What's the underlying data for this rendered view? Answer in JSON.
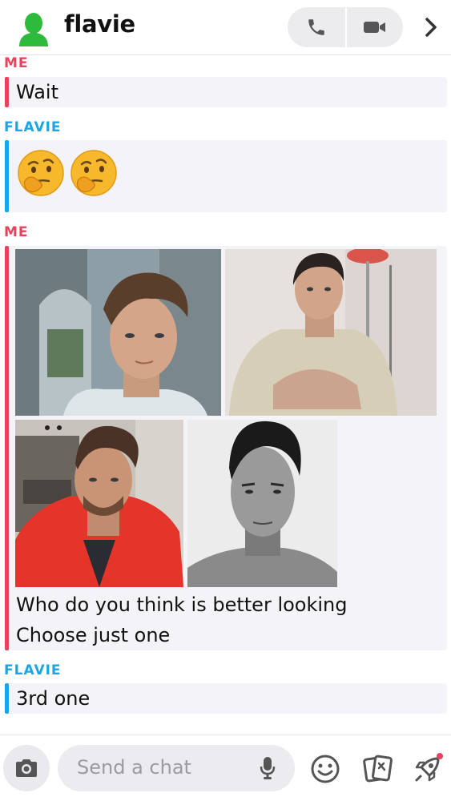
{
  "header": {
    "title": "flavie",
    "avatar_color": "#2eba3c"
  },
  "colors": {
    "me": "#e8425c",
    "flavie": "#1aa5e6",
    "bubble_bg": "#f4f4f8"
  },
  "messages": [
    {
      "sender": "ME",
      "text": "Wait"
    },
    {
      "sender": "FLAVIE",
      "emojis": [
        "thinking-face-emoji",
        "thinking-face-emoji"
      ]
    },
    {
      "sender": "ME",
      "photos": [
        "photo-1",
        "photo-2",
        "photo-3",
        "photo-4"
      ],
      "text_line1": "Who do you think is better looking",
      "text_line2": "Choose just one"
    },
    {
      "sender": "FLAVIE",
      "text": "3rd one"
    }
  ],
  "composer": {
    "placeholder": "Send a chat"
  }
}
